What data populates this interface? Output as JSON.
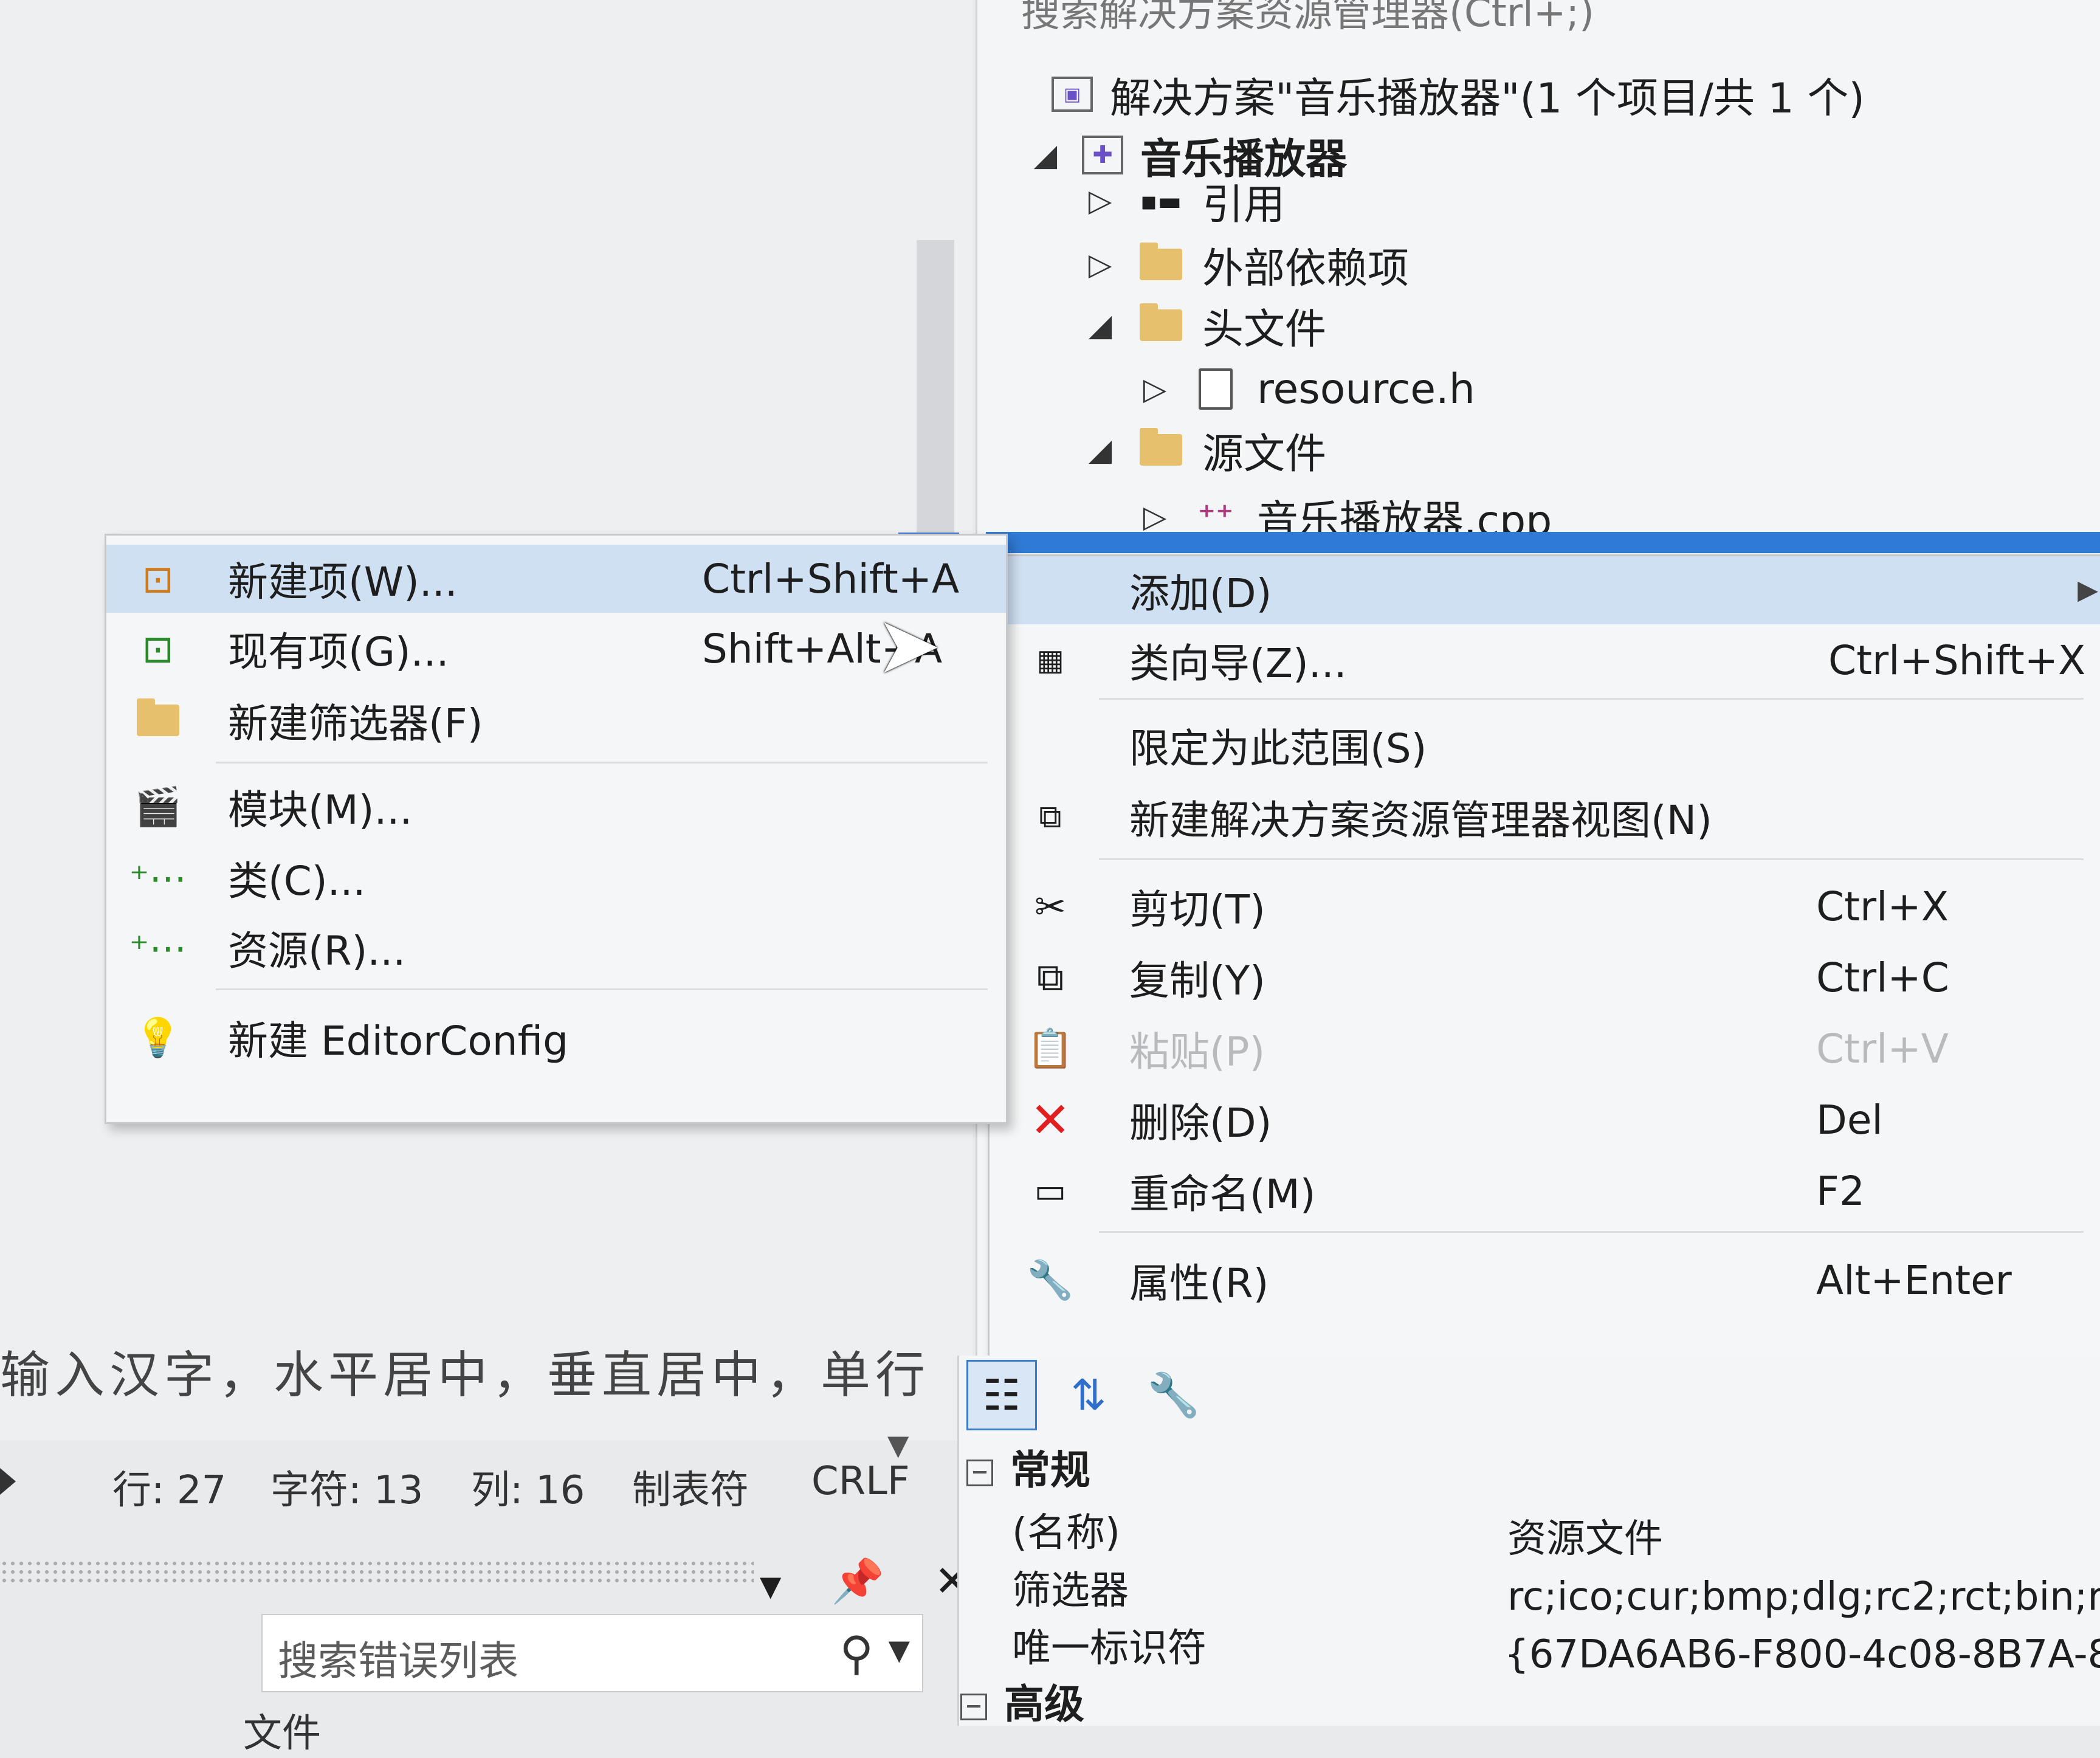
{
  "solution_explorer": {
    "search_hint": "搜索解决方案资源管理器(Ctrl+;)",
    "solution": "解决方案\"音乐播放器\"(1 个项目/共 1 个)",
    "project": "音乐播放器",
    "nodes": [
      {
        "label": "引用",
        "icon": "references-icon"
      },
      {
        "label": "外部依赖项",
        "icon": "external-deps-icon"
      },
      {
        "label": "头文件",
        "icon": "filter-folder-icon"
      },
      {
        "label": "resource.h",
        "icon": "header-file-icon"
      },
      {
        "label": "源文件",
        "icon": "filter-folder-icon"
      },
      {
        "label": "音乐播放器.cpp",
        "icon": "cpp-file-icon"
      }
    ]
  },
  "context_menu": {
    "items": [
      {
        "label": "添加(D)",
        "shortcut": ""
      },
      {
        "label": "类向导(Z)...",
        "shortcut": "Ctrl+Shift+X"
      },
      {
        "label": "限定为此范围(S)",
        "shortcut": ""
      },
      {
        "label": "新建解决方案资源管理器视图(N)",
        "shortcut": ""
      },
      {
        "label": "剪切(T)",
        "shortcut": "Ctrl+X"
      },
      {
        "label": "复制(Y)",
        "shortcut": "Ctrl+C"
      },
      {
        "label": "粘贴(P)",
        "shortcut": "Ctrl+V"
      },
      {
        "label": "删除(D)",
        "shortcut": "Del"
      },
      {
        "label": "重命名(M)",
        "shortcut": "F2"
      },
      {
        "label": "属性(R)",
        "shortcut": "Alt+Enter"
      }
    ]
  },
  "add_submenu": {
    "items": [
      {
        "label": "新建项(W)...",
        "shortcut": "Ctrl+Shift+A"
      },
      {
        "label": "现有项(G)...",
        "shortcut": "Shift+Alt+A"
      },
      {
        "label": "新建筛选器(F)",
        "shortcut": ""
      },
      {
        "label": "模块(M)...",
        "shortcut": ""
      },
      {
        "label": "类(C)...",
        "shortcut": ""
      },
      {
        "label": "资源(R)...",
        "shortcut": ""
      },
      {
        "label": "新建 EditorConfig",
        "shortcut": ""
      }
    ]
  },
  "editor": {
    "text_line": "输入汉字，水平居中，垂直居中，单行"
  },
  "status_bar": {
    "line": "行: 27",
    "char": "字符: 13",
    "col": "列: 16",
    "tabs": "制表符",
    "eol": "CRLF"
  },
  "error_list": {
    "search_placeholder": "搜索错误列表",
    "column_partial": "文件"
  },
  "properties": {
    "category_general": "常规",
    "category_advanced": "高级",
    "rows": [
      {
        "name": "(名称)",
        "value": "资源文件"
      },
      {
        "name": "筛选器",
        "value": "rc;ico;cur;bmp;dlg;rc2;rct;bin;r"
      },
      {
        "name": "唯一标识符",
        "value": "{67DA6AB6-F800-4c08-8B7A-8"
      }
    ]
  },
  "colors": {
    "selection": "#2f7ad4",
    "highlight": "#cfe0f3",
    "delete_red": "#e02020"
  }
}
